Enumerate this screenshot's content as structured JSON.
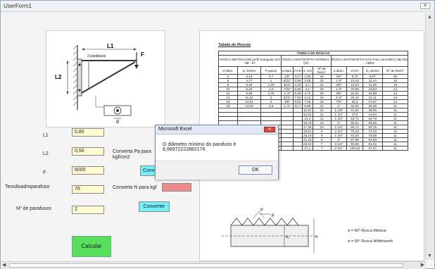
{
  "window": {
    "title": "UserForm1",
    "close_glyph": "✕"
  },
  "diagram": {
    "L1": "L1",
    "L2": "L2",
    "F": "F",
    "d": "d",
    "bolts_note": "2 parafusos"
  },
  "form": {
    "L1": {
      "label": "L1",
      "value": "0,80"
    },
    "L2": {
      "label": "L2",
      "value": "0,50"
    },
    "F": {
      "label": "F",
      "value": "6000"
    },
    "tensao": {
      "label": "Tensãoadmparafuso",
      "value": "76"
    },
    "num_parafusos": {
      "label": "Nº de parafusos",
      "value": "2"
    },
    "convert_pa_label": "Converta Pa para kgf/cm2",
    "convert_n_label": "Converta N para kgf",
    "convert_button_1": "Conver",
    "convert_button_2": "Converter",
    "calc_button": "Calcular"
  },
  "colors": {
    "field_bg": "#fffbd0",
    "cyan_button": "#74f0f6",
    "green_button": "#58e05a",
    "pink_box": "#f08a8a"
  },
  "sheet": {
    "title": "Tabela de Roscas",
    "table_title": "TABELA DE ROSCAS",
    "groups": [
      {
        "title": "ROSCA MÉTRICA(M) perfil triangular ISO NB - 97"
      },
      {
        "title": "ROSCA WHITWORTH NORMAL (W)"
      },
      {
        "title": "ROSCA WHITWORTH GÁS Para canos(RC) NB 202 - ABNT"
      }
    ],
    "headers": [
      "d diam.",
      "d₁ núcleo",
      "P passo",
      "d diam.",
      "d mm",
      "d₁ mm",
      "Nº de fios/1\"",
      "d diam.",
      "d mm",
      "d₁ núcleo",
      "Nº de fios/1\""
    ],
    "rows": [
      [
        "4",
        "3,14",
        "0,7",
        "1/8\"",
        "3,17",
        "2,36",
        "40",
        "1/8\"",
        "9,73",
        "8,57",
        "28"
      ],
      [
        "6",
        "4,77",
        "1",
        "5/32\"",
        "3,96",
        "2,95",
        "32",
        "1 /4\"",
        "13,15",
        "11,44",
        "19"
      ],
      [
        "8",
        "6,46",
        "1,25",
        "3/16\"",
        "4,76",
        "3,4",
        "24",
        "3/8\"",
        "16,63",
        "14,95",
        "19"
      ],
      [
        "10",
        "8,16",
        "1,5",
        "7/32\"",
        "5,55",
        "4,2",
        "20",
        "1 /2\"",
        "20,95",
        "18,63",
        "14"
      ],
      [
        "12",
        "9,85",
        "1,75",
        "1 /4\"",
        "6,35",
        "4,72",
        "20",
        "5/8\"",
        "22,91",
        "20,59",
        "14"
      ],
      [
        "14",
        "11,54",
        "2",
        "5/16\"",
        "7,93",
        "6,13",
        "18",
        "3 /4\"",
        "26,44",
        "24,11",
        "14"
      ],
      [
        "16",
        "13,54",
        "2",
        "3/8\"",
        "9,52",
        "7,49",
        "16",
        "7/8\"",
        "30,2",
        "27,87",
        "14"
      ],
      [
        "18",
        "14,93",
        "2,5",
        "1 /2\"",
        "12,7",
        "9,99",
        "12",
        "1\"",
        "33,25",
        "30,29",
        "11"
      ],
      [
        "",
        "",
        "",
        "",
        "",
        "11,57",
        "12",
        "1 1/8\"",
        "41,91",
        "38,95",
        "11"
      ],
      [
        "",
        "",
        "",
        "",
        "",
        "12,91",
        "11",
        "1 1/2\"",
        "47,8",
        "44,84",
        "11"
      ],
      [
        "",
        "",
        "",
        "",
        "",
        "14,3",
        "11",
        "1 3/4\"",
        "53,74",
        "50,79",
        "11"
      ],
      [
        "",
        "",
        "",
        "",
        "",
        "16,79",
        "10",
        "2\"",
        "59,61",
        "56,65",
        "11"
      ],
      [
        "",
        "",
        "",
        "",
        "",
        "17,38",
        "10",
        "2 1/4\"",
        "65,71",
        "62,75",
        "11"
      ],
      [
        "",
        "",
        "",
        "",
        "",
        "18,61",
        "9",
        "2 1/2\"",
        "75,18",
        "72,23",
        "11"
      ],
      [
        "",
        "",
        "",
        "",
        "",
        "20,19",
        "9",
        "2 3/4\"",
        "81,53",
        "78,58",
        "11"
      ],
      [
        "",
        "",
        "",
        "",
        "",
        "21,33",
        "8",
        "3\"",
        "87,88",
        "84,93",
        "11"
      ],
      [
        "",
        "",
        "",
        "",
        "",
        "23,92",
        "7",
        "3 1/4\"",
        "93,98",
        "91,02",
        "11"
      ],
      [
        "",
        "",
        "",
        "",
        "",
        "27,1",
        "7",
        "3 1/2\"",
        "100,33",
        "97,37",
        "11"
      ]
    ],
    "alpha_metric": "α = 60° Rosca Métrica",
    "alpha_whitworth": "α = 55° Rosca Whithworth",
    "profile_labels": {
      "alpha": "α",
      "p": "p",
      "d1": "d₁",
      "d": "d"
    }
  },
  "dialog": {
    "title": "Microsoft Excel",
    "message": "O diâmetro mínimo do parafuso é 8,96972222882176",
    "ok_label": "OK",
    "close_glyph": "✕"
  }
}
